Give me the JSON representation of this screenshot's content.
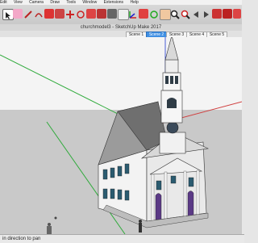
{
  "menubar": {
    "items": [
      "Edit",
      "View",
      "Camera",
      "Draw",
      "Tools",
      "Window",
      "Extensions",
      "Help"
    ]
  },
  "toolbar": {
    "icons": [
      "select-icon",
      "eraser-icon",
      "line-icon",
      "arc-icon",
      "shape-icon",
      "push-pull-icon",
      "move-icon",
      "rotate-icon",
      "scale-icon",
      "offset-icon",
      "tape-measure-icon",
      "text-icon",
      "axes-icon",
      "paint-bucket-icon",
      "orbit-icon",
      "pan-icon",
      "zoom-icon",
      "zoom-extents-icon",
      "previous-view-icon",
      "next-view-icon",
      "warehouse-icon",
      "extension-warehouse-icon",
      "layout-icon"
    ]
  },
  "window": {
    "title": "churchmodel3 - SketchUp Make 2017"
  },
  "scenes": {
    "tabs": [
      "Scene 1",
      "Scene 2",
      "Scene 3",
      "Scene 4",
      "Scene 5"
    ],
    "active_index": 1
  },
  "status": {
    "text": "in direction to pan"
  },
  "colors": {
    "sky": "#f4f4f4",
    "ground": "#c9c9c9",
    "accent": "#3f8fe3",
    "door": "#5b3a86"
  }
}
